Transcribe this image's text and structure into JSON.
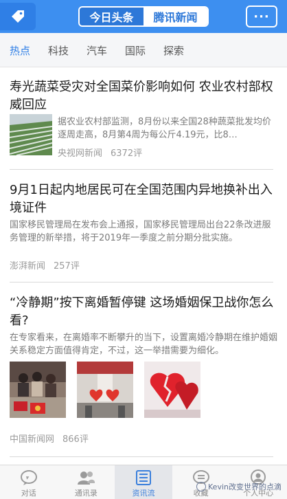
{
  "header": {
    "segments": [
      "今日头条",
      "腾讯新闻"
    ],
    "active_segment": "今日头条",
    "more_label": "···"
  },
  "categories": [
    "热点",
    "科技",
    "汽车",
    "国际",
    "探索"
  ],
  "active_category": "热点",
  "articles": [
    {
      "title": "寿光蔬菜受灾对全国菜价影响如何 农业农村部权威回应",
      "summary": "据农业农村部监测，8月份以来全国28种蔬菜批发均价逐周走高，8月第4周为每公斤4.19元，比8…",
      "source": "央视网新闻",
      "comments": "6372评"
    },
    {
      "title": "9月1日起内地居民可在全国范围内异地换补出入境证件",
      "summary": "国家移民管理局在发布会上通报，国家移民管理局出台22条改进服务管理的新举措，将于2019年一季度之前分期分批实施。",
      "source": "澎湃新闻",
      "comments": "257评"
    },
    {
      "title": "“冷静期”按下离婚暂停键 这场婚姻保卫战你怎么看?",
      "summary": "在专家看来，在离婚率不断攀升的当下，设置离婚冷静期在维护婚姻关系稳定方面值得肯定，不过，这一举措需要为细化。",
      "source": "中国新闻网",
      "comments": "866评"
    }
  ],
  "tabbar": {
    "items": [
      "对话",
      "通讯录",
      "资讯流",
      "收藏",
      "个人中心"
    ],
    "active": "资讯流"
  },
  "watermark": "Kevin改变世界的点滴",
  "colors": {
    "header_blue": "#3d8ff0",
    "accent_blue": "#2f7fe6",
    "meta_gray": "#9a9a9a"
  }
}
